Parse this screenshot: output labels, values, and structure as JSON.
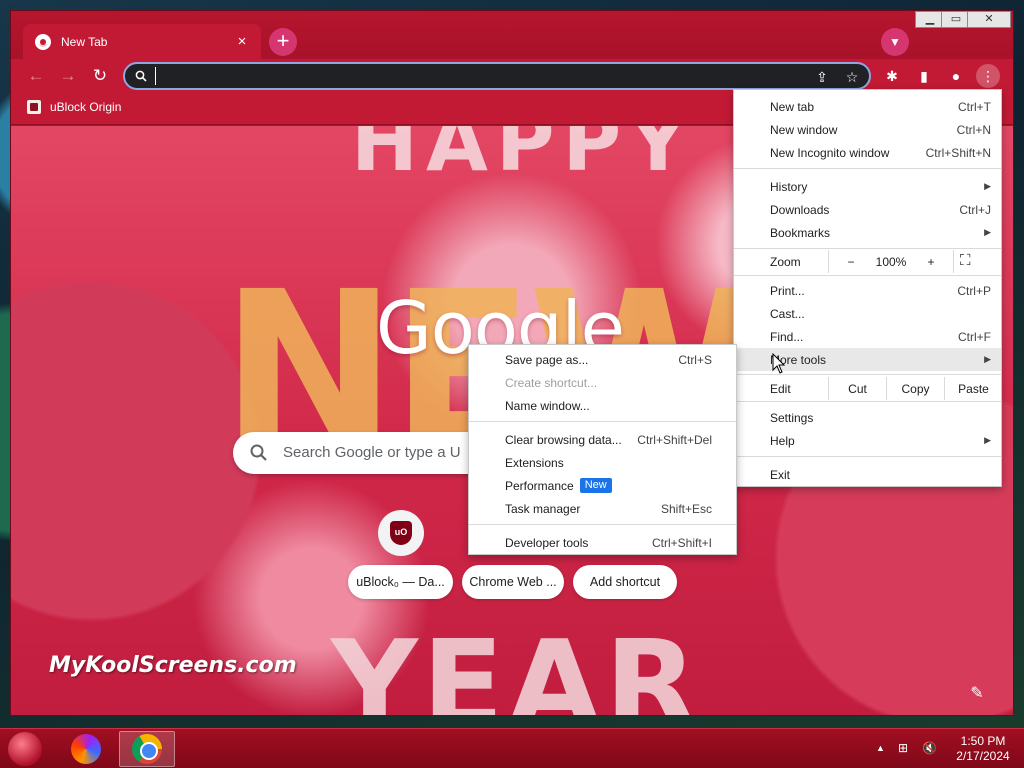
{
  "tab": {
    "title": "New Tab",
    "close": "×"
  },
  "window_controls": {
    "minimize": "▁",
    "maximize": "▭",
    "close": "✕"
  },
  "toolbar": {
    "back": "←",
    "forward": "→",
    "reload": "↻",
    "omnibox_value": "",
    "share": "⇪",
    "bookmark_star": "☆",
    "extensions": "✱",
    "side_panel": "▮",
    "profile": "●",
    "menu": "⋮"
  },
  "bookmarks": {
    "items": [
      {
        "label": "uBlock Origin"
      }
    ]
  },
  "ntp": {
    "logo": "Google",
    "search_placeholder": "Search Google or type a U",
    "shortcut_badge": "uO",
    "chips": [
      {
        "label": "uBlock₀ — Da..."
      },
      {
        "label": "Chrome Web ..."
      },
      {
        "label": "Add shortcut"
      }
    ],
    "watermark": "MyKoolScreens.com",
    "customize": "✎",
    "deco_letters": {
      "top": "HAPPY",
      "middle": "NEW",
      "bottom": "YEAR"
    }
  },
  "menu": {
    "new_tab": {
      "label": "New tab",
      "accel": "Ctrl+T"
    },
    "new_window": {
      "label": "New window",
      "accel": "Ctrl+N"
    },
    "new_incognito": {
      "label": "New Incognito window",
      "accel": "Ctrl+Shift+N"
    },
    "history": {
      "label": "History"
    },
    "downloads": {
      "label": "Downloads",
      "accel": "Ctrl+J"
    },
    "bookmarks": {
      "label": "Bookmarks"
    },
    "zoom": {
      "label": "Zoom",
      "minus": "−",
      "value": "100%",
      "plus": "+",
      "fullscreen": "⛶"
    },
    "print": {
      "label": "Print...",
      "accel": "Ctrl+P"
    },
    "cast": {
      "label": "Cast..."
    },
    "find": {
      "label": "Find...",
      "accel": "Ctrl+F"
    },
    "more_tools": {
      "label": "More tools"
    },
    "edit": {
      "label": "Edit",
      "cut": "Cut",
      "copy": "Copy",
      "paste": "Paste"
    },
    "settings": {
      "label": "Settings"
    },
    "help": {
      "label": "Help"
    },
    "exit": {
      "label": "Exit"
    },
    "arrow": "▶"
  },
  "submenu": {
    "save_page": {
      "label": "Save page as...",
      "accel": "Ctrl+S"
    },
    "create_shortcut": {
      "label": "Create shortcut..."
    },
    "name_window": {
      "label": "Name window..."
    },
    "clear_browsing": {
      "label": "Clear browsing data...",
      "accel": "Ctrl+Shift+Del"
    },
    "extensions": {
      "label": "Extensions"
    },
    "performance": {
      "label": "Performance",
      "badge": "New"
    },
    "task_manager": {
      "label": "Task manager",
      "accel": "Shift+Esc"
    },
    "developer_tools": {
      "label": "Developer tools",
      "accel": "Ctrl+Shift+I"
    }
  },
  "taskbar": {
    "tray_arrow": "▲",
    "network": "⊞",
    "volume": "🔇",
    "time": "1:50 PM",
    "date": "2/17/2024"
  },
  "colors": {
    "frame": "#b3102a",
    "toolbar": "#c21a35",
    "accent_blue": "#1a73e8",
    "taskbar": "#8f0b1c"
  },
  "icons": [
    "chrome-favicon",
    "close-icon",
    "plus-icon",
    "chevron-down-icon",
    "back-icon",
    "forward-icon",
    "reload-icon",
    "search-icon",
    "share-icon",
    "star-icon",
    "puzzle-icon",
    "side-panel-icon",
    "profile-icon",
    "kebab-menu-icon",
    "ublock-icon",
    "pencil-icon",
    "fullscreen-icon",
    "firefox-icon",
    "chrome-icon"
  ]
}
